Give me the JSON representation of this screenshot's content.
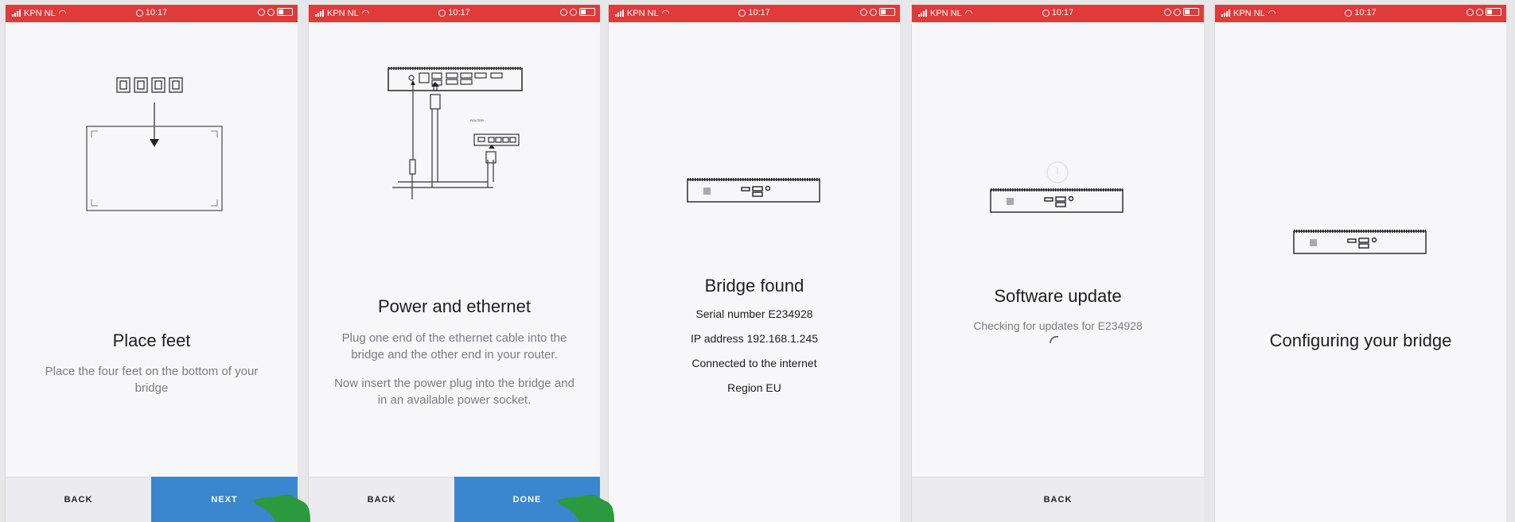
{
  "status_bar": {
    "carrier": "KPN NL",
    "time": "10:17"
  },
  "screens": [
    {
      "title": "Place feet",
      "body": "Place the four feet on the bottom of your bridge",
      "back_label": "BACK",
      "next_label": "NEXT"
    },
    {
      "title": "Power and ethernet",
      "body1": "Plug one end of the ethernet cable into the bridge and the other end in your router.",
      "body2": "Now insert the power plug into the bridge and in an available power socket.",
      "router_label": "ROUTER",
      "back_label": "BACK",
      "done_label": "DONE"
    },
    {
      "title": "Bridge found",
      "serial": "Serial number E234928",
      "ip": "IP address 192.168.1.245",
      "internet": "Connected to the internet",
      "region": "Region EU"
    },
    {
      "title": "Software update",
      "status": "Checking for updates for E234928",
      "back_label": "BACK"
    },
    {
      "title": "Configuring your bridge"
    }
  ],
  "colors": {
    "status_bar": "#e03a3b",
    "accent": "#3a86cf",
    "hand": "#2b9a3e"
  }
}
